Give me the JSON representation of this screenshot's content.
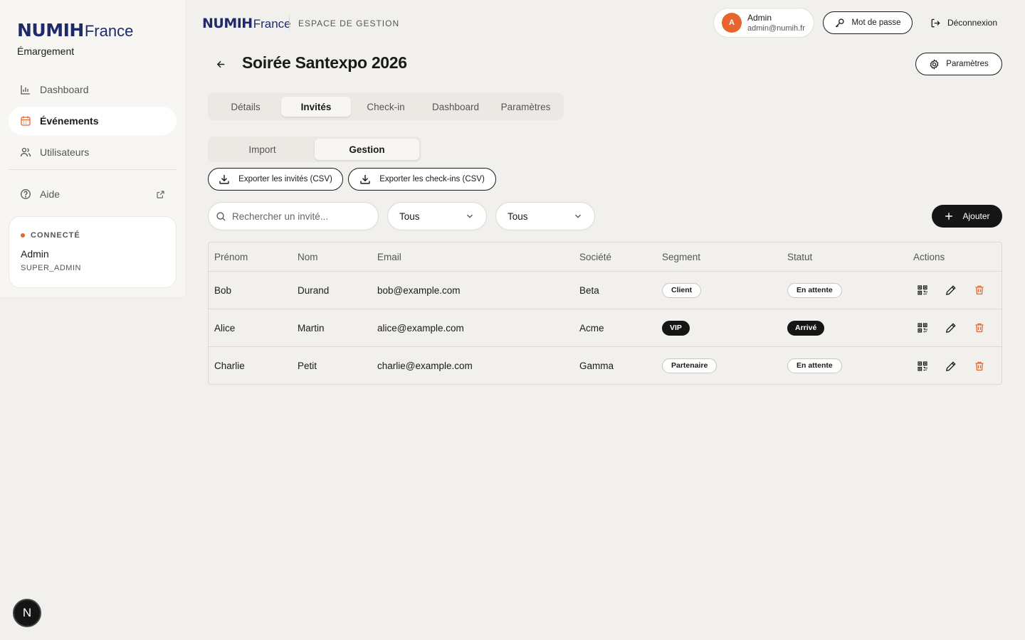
{
  "brand": {
    "logo_main": "NUMIH",
    "logo_sub": "France"
  },
  "sidebar": {
    "app_name": "Émargement",
    "items": [
      {
        "label": "Dashboard",
        "icon": "chart-icon"
      },
      {
        "label": "Événements",
        "icon": "calendar-icon"
      },
      {
        "label": "Utilisateurs",
        "icon": "users-icon"
      }
    ],
    "help": {
      "label": "Aide",
      "icon": "help-icon"
    },
    "status": {
      "label": "CONNECTÉ",
      "user": "Admin",
      "role": "SUPER_ADMIN"
    }
  },
  "header": {
    "section": "ESPACE DE GESTION",
    "account": {
      "initial": "A",
      "name": "Admin",
      "email": "admin@numih.fr"
    },
    "password_label": "Mot de passe",
    "logout_label": "Déconnexion"
  },
  "page": {
    "title": "Soirée Santexpo 2026",
    "settings_label": "Paramètres",
    "tabs": [
      "Détails",
      "Invités",
      "Check-in",
      "Dashboard",
      "Paramètres"
    ],
    "subtabs": [
      "Import",
      "Gestion"
    ],
    "export_guests": "Exporter les invités (CSV)",
    "export_checkins": "Exporter les check-ins (CSV)",
    "search_placeholder": "Rechercher un invité...",
    "filter1": "Tous",
    "filter2": "Tous",
    "add_label": "Ajouter"
  },
  "table": {
    "headers": [
      "Prénom",
      "Nom",
      "Email",
      "Société",
      "Segment",
      "Statut",
      "Actions"
    ],
    "rows": [
      {
        "first": "Bob",
        "last": "Durand",
        "email": "bob@example.com",
        "company": "Beta",
        "segment": "Client",
        "status": "En attente"
      },
      {
        "first": "Alice",
        "last": "Martin",
        "email": "alice@example.com",
        "company": "Acme",
        "segment": "VIP",
        "status": "Arrivé"
      },
      {
        "first": "Charlie",
        "last": "Petit",
        "email": "charlie@example.com",
        "company": "Gamma",
        "segment": "Partenaire",
        "status": "En attente"
      }
    ]
  },
  "footer_badge": "N",
  "colors": {
    "accent": "#e8652e",
    "dark": "#151515",
    "brand": "#1f2a6b",
    "background": "#f2f0ed"
  }
}
